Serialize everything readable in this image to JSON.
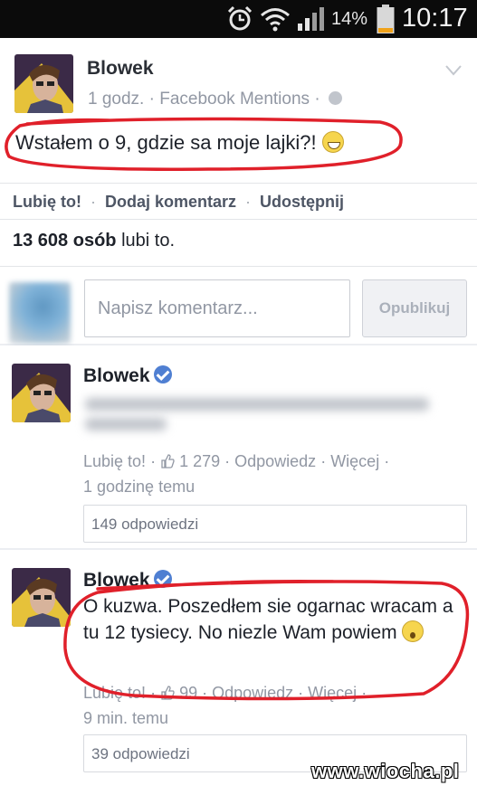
{
  "status_bar": {
    "battery_percent": "14%",
    "time": "10:17",
    "icons": [
      "alarm-icon",
      "wifi-icon",
      "signal-icon",
      "battery-icon"
    ]
  },
  "post": {
    "author": "Blowek",
    "time_ago": "1 godz.",
    "source": "Facebook Mentions",
    "text": "Wstałem o 9, gdzie sa moje lajki?!",
    "actions": {
      "like": "Lubię to!",
      "comment": "Dodaj komentarz",
      "share": "Udostępnij"
    },
    "likes_count": "13 608 osób",
    "likes_suffix": "lubi to."
  },
  "composer": {
    "placeholder": "Napisz komentarz...",
    "publish_label": "Opublikuj"
  },
  "comments": [
    {
      "author": "Blowek",
      "like_label": "Lubię to!",
      "like_count": "1 279",
      "reply_label": "Odpowiedz",
      "more_label": "Więcej",
      "time": "1 godzinę temu",
      "replies": "149 odpowiedzi"
    },
    {
      "author": "Blowek",
      "text": "O kuzwa. Poszedłem sie ogarnac wracam a tu 12 tysiecy. No niezle Wam powiem",
      "like_label": "Lubię to!",
      "like_count": "99",
      "reply_label": "Odpowiedz",
      "more_label": "Więcej",
      "time": "9 min. temu",
      "replies": "39 odpowiedzi"
    }
  ],
  "watermark": "www.wiocha.pl",
  "colors": {
    "highlight": "#e0202a",
    "verified": "#4f7fd2",
    "meta": "#9197a3"
  }
}
